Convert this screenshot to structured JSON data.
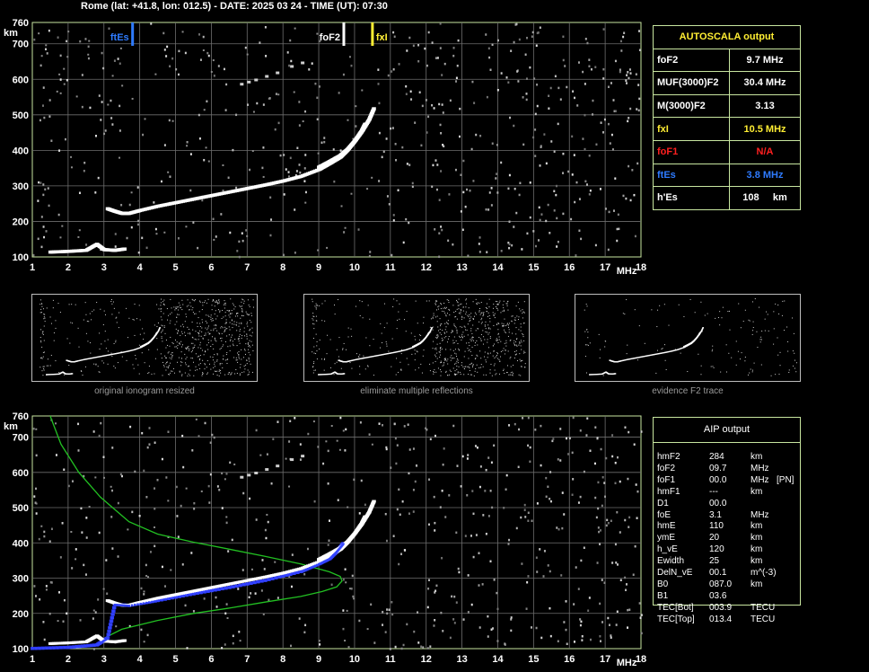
{
  "header": "Rome (lat: +41.8, lon: 012.5) - DATE: 2025 03 24 - TIME (UT): 07:30",
  "axis": {
    "y_unit": "km",
    "x_unit": "MHz",
    "y_ticks": [
      "760",
      "700",
      "600",
      "500",
      "400",
      "300",
      "200",
      "100"
    ],
    "x_ticks": [
      "1",
      "2",
      "3",
      "4",
      "5",
      "6",
      "7",
      "8",
      "9",
      "10",
      "11",
      "12",
      "13",
      "14",
      "15",
      "16",
      "17",
      "18"
    ]
  },
  "markers": [
    {
      "label": "ftEs",
      "freq": 3.8,
      "color": "#2e7bff"
    },
    {
      "label": "foF2",
      "freq": 9.7,
      "color": "#ffffff"
    },
    {
      "label": "fxI",
      "freq": 10.5,
      "color": "#ffee33"
    }
  ],
  "autoscala": {
    "title": "AUTOSCALA output",
    "rows": [
      {
        "label": "foF2",
        "value": "9.7 MHz",
        "color": "#ffffff"
      },
      {
        "label": "MUF(3000)F2",
        "value": "30.4 MHz",
        "color": "#ffffff"
      },
      {
        "label": "M(3000)F2",
        "value": "3.13",
        "color": "#ffffff"
      },
      {
        "label": "fxI",
        "value": "10.5 MHz",
        "color": "#ffee33"
      },
      {
        "label": "foF1",
        "value": "N/A",
        "color": "#ff2020"
      },
      {
        "label": "ftEs",
        "value": "3.8 MHz",
        "color": "#2e7bff"
      },
      {
        "label": "h'Es",
        "value": "108     km",
        "color": "#ffffff"
      }
    ]
  },
  "thumbnails": [
    {
      "caption": "original ionogram resized"
    },
    {
      "caption": "eliminate multiple reflections"
    },
    {
      "caption": "evidence F2 trace"
    }
  ],
  "aip": {
    "title": "AIP output",
    "rows": [
      {
        "name": "hmF2",
        "value": "284",
        "unit": "km",
        "extra": ""
      },
      {
        "name": "foF2",
        "value": "09.7",
        "unit": "MHz",
        "extra": ""
      },
      {
        "name": "foF1",
        "value": "00.0",
        "unit": "MHz",
        "extra": "[PN]"
      },
      {
        "name": "hmF1",
        "value": "---",
        "unit": "km",
        "extra": ""
      },
      {
        "name": "D1",
        "value": "00.0",
        "unit": "",
        "extra": ""
      },
      {
        "name": "foE",
        "value": "3.1",
        "unit": "MHz",
        "extra": ""
      },
      {
        "name": "hmE",
        "value": "110",
        "unit": "km",
        "extra": ""
      },
      {
        "name": "ymE",
        "value": "20",
        "unit": "km",
        "extra": ""
      },
      {
        "name": "h_vE",
        "value": "120",
        "unit": "km",
        "extra": ""
      },
      {
        "name": "Ewidth",
        "value": "25",
        "unit": "km",
        "extra": ""
      },
      {
        "name": "DelN_vE",
        "value": "00.1",
        "unit": "m^(-3)",
        "extra": ""
      },
      {
        "name": "B0",
        "value": "087.0",
        "unit": "km",
        "extra": ""
      },
      {
        "name": "B1",
        "value": "03.6",
        "unit": "",
        "extra": ""
      },
      {
        "name": "TEC[Bot]",
        "value": "003.9",
        "unit": "TECU",
        "extra": ""
      },
      {
        "name": "TEC[Top]",
        "value": "013.4",
        "unit": "TECU",
        "extra": ""
      }
    ]
  },
  "chart_data": [
    {
      "type": "scatter",
      "title": "",
      "xlabel": "MHz",
      "ylabel": "km",
      "xlim": [
        1,
        18
      ],
      "ylim": [
        100,
        760
      ],
      "grid": true,
      "series": [
        {
          "name": "",
          "role": "F2 trace (o-mode)",
          "color": "#ffffff",
          "x": [
            3.1,
            3.3,
            3.5,
            3.7,
            4.0,
            4.5,
            5.0,
            5.5,
            6.0,
            6.5,
            7.0,
            7.5,
            8.0,
            8.5,
            9.0,
            9.3,
            9.6,
            9.8,
            10.0,
            10.2,
            10.3
          ],
          "y": [
            235,
            228,
            222,
            222,
            230,
            242,
            252,
            262,
            272,
            282,
            292,
            302,
            313,
            326,
            345,
            362,
            380,
            400,
            425,
            455,
            475
          ]
        },
        {
          "name": "",
          "role": "F2 trace (x-mode)",
          "color": "#ffffff",
          "x": [
            9.0,
            9.3,
            9.6,
            9.8,
            10.0,
            10.2,
            10.4,
            10.55
          ],
          "y": [
            352,
            368,
            385,
            402,
            425,
            452,
            485,
            520
          ]
        },
        {
          "name": "",
          "role": "Es trace",
          "color": "#ffffff",
          "x": [
            1.5,
            2.0,
            2.5,
            2.8,
            3.0,
            3.3,
            3.6
          ],
          "y": [
            113,
            115,
            118,
            135,
            120,
            118,
            122
          ]
        }
      ]
    },
    {
      "type": "line",
      "title": "",
      "xlabel": "MHz",
      "ylabel": "km",
      "xlim": [
        1,
        18
      ],
      "ylim": [
        100,
        760
      ],
      "grid": true,
      "series": [
        {
          "name": "",
          "role": "electron density profile",
          "color": "#22c022",
          "x": [
            1.4,
            2.0,
            2.5,
            2.9,
            3.0,
            3.1,
            3.5,
            4.5,
            5.5,
            6.5,
            7.5,
            8.5,
            9.1,
            9.5,
            9.65,
            9.6,
            9.3,
            8.5,
            7.5,
            6.5,
            5.5,
            4.5,
            3.7,
            2.9,
            2.3,
            1.8,
            1.5
          ],
          "y": [
            102,
            104,
            108,
            114,
            125,
            135,
            155,
            180,
            200,
            215,
            232,
            248,
            262,
            275,
            292,
            305,
            318,
            340,
            362,
            382,
            402,
            425,
            460,
            530,
            600,
            680,
            760
          ]
        },
        {
          "name": "",
          "role": "true height profile",
          "color": "#2e3bff",
          "x": [
            1.0,
            2.0,
            2.8,
            3.1,
            3.3,
            3.7,
            4.5,
            5.5,
            6.5,
            7.5,
            8.5,
            9.0,
            9.3,
            9.5,
            9.7
          ],
          "y": [
            100,
            103,
            110,
            130,
            225,
            222,
            236,
            255,
            273,
            293,
            318,
            340,
            355,
            375,
            400
          ]
        }
      ]
    }
  ]
}
